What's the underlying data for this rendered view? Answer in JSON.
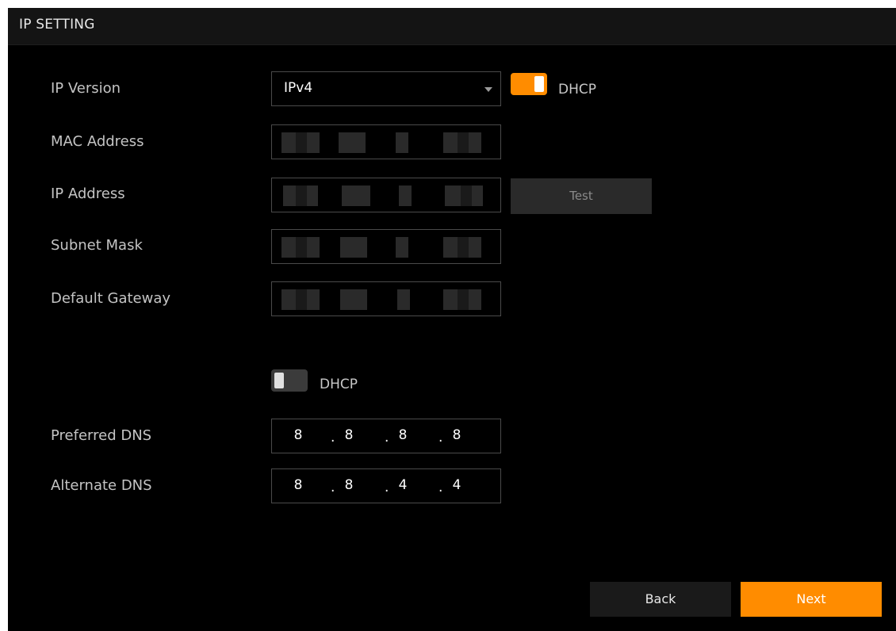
{
  "window": {
    "title": "IP SETTING"
  },
  "form": {
    "ip_version": {
      "label": "IP Version",
      "value": "IPv4"
    },
    "dhcp_ip": {
      "label": "DHCP",
      "enabled": true
    },
    "mac_address": {
      "label": "MAC Address"
    },
    "ip_address": {
      "label": "IP Address"
    },
    "subnet_mask": {
      "label": "Subnet Mask"
    },
    "default_gateway": {
      "label": "Default Gateway"
    },
    "dhcp_dns": {
      "label": "DHCP",
      "enabled": false
    },
    "preferred_dns": {
      "label": "Preferred DNS",
      "octets": [
        "8",
        "8",
        "8",
        "8"
      ]
    },
    "alternate_dns": {
      "label": "Alternate DNS",
      "octets": [
        "8",
        "8",
        "4",
        "4"
      ]
    }
  },
  "buttons": {
    "test": "Test",
    "back": "Back",
    "next": "Next"
  },
  "colors": {
    "accent": "#ff8c00",
    "background": "#000000",
    "titlebar": "#141414"
  }
}
